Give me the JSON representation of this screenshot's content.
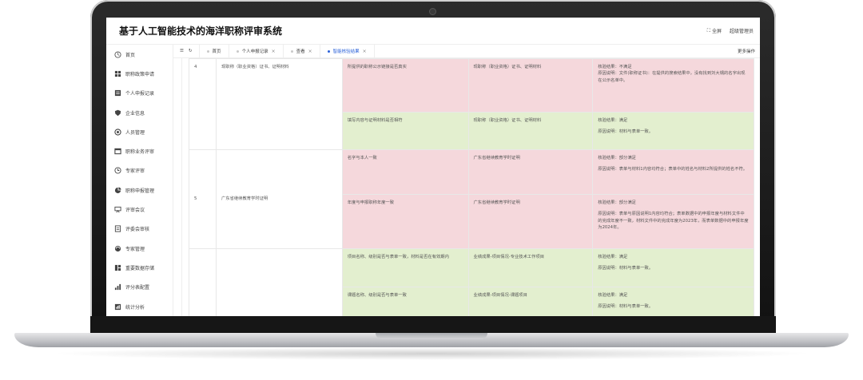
{
  "app": {
    "title": "基于人工智能技术的海洋职称评审系统",
    "fullscreen_label": "全屏",
    "user_label": "超级管理员"
  },
  "sidebar": {
    "items": [
      {
        "label": "首页",
        "icon": "home-icon"
      },
      {
        "label": "职称政策申请",
        "icon": "grid-icon"
      },
      {
        "label": "个人申报记录",
        "icon": "record-icon"
      },
      {
        "label": "企业信息",
        "icon": "shield-icon"
      },
      {
        "label": "人员管理",
        "icon": "person-icon"
      },
      {
        "label": "职称业务评审",
        "icon": "review-icon"
      },
      {
        "label": "专家评审",
        "icon": "clock-icon"
      },
      {
        "label": "职称申报管理",
        "icon": "pie-icon"
      },
      {
        "label": "评审会议",
        "icon": "meeting-icon"
      },
      {
        "label": "评委会审核",
        "icon": "audit-icon"
      },
      {
        "label": "专家管理",
        "icon": "expert-icon"
      },
      {
        "label": "重要数据存储",
        "icon": "storage-icon"
      },
      {
        "label": "评分表配置",
        "icon": "config-icon"
      },
      {
        "label": "统计分析",
        "icon": "stats-icon"
      }
    ]
  },
  "tabs": {
    "items": [
      {
        "label": "首页",
        "closable": false,
        "active": false
      },
      {
        "label": "个人申报记录",
        "closable": true,
        "active": false
      },
      {
        "label": "查看",
        "closable": true,
        "active": false
      },
      {
        "label": "智能核验结果",
        "closable": true,
        "active": true
      }
    ],
    "close_glyph": "×",
    "right_label": "更多操作"
  },
  "table": {
    "groups": [
      {
        "no": "4",
        "name": "现职称（职业资格）证书、证明材料",
        "rows": [
          {
            "status": "fail",
            "condition": "所提供的职称公示链接是否真实",
            "source": "现职称（职业资格）证书、证明材料",
            "result_title": "核验结果：不满足",
            "result_reason": "原因说明：文件(职称证书)：在提供的搜索结果中，没有找到刘大锅的名字出现在公示名单中。"
          },
          {
            "status": "pass",
            "condition": "填写内容与证明材料是否相符",
            "source": "现职称（职业资格）证书、证明材料",
            "result_title": "核验结果：满足",
            "result_reason": "原因说明：材料与表单一致。"
          }
        ]
      },
      {
        "no": "5",
        "name": "广东省继续教育学时证明",
        "rows": [
          {
            "status": "fail",
            "condition": "名字与本人一致",
            "source": "广东省继续教育学时证明",
            "result_title": "核验结果：部分满足",
            "result_reason": "原因说明：表单与材料1内容均符合；表单中的姓名与材料2所提供的姓名不符。"
          },
          {
            "status": "fail",
            "condition": "年度与申报职称年度一致",
            "source": "广东省继续教育学时证明",
            "result_title": "核验结果：部分满足",
            "result_reason": "原因说明：表单与原因说明1内容均符合；表单数据中的申报年度与材料文件中的完成年度不一致，材料文件中的完成年度为2023年，而表单数据中的申报年度为2024年。"
          }
        ]
      },
      {
        "no": "",
        "name": "",
        "rows": [
          {
            "status": "pass",
            "condition": "项目名称、级别是否与表单一致，材料是否在有效期内",
            "source": "业绩成果-项目情况-专业技术工作项目",
            "result_title": "核验结果：满足",
            "result_reason": "原因说明：材料与表单一致。"
          },
          {
            "status": "pass",
            "condition": "课题名称、级别是否与表单一致",
            "source": "业绩成果-项目情况-课题项目",
            "result_title": "核验结果：满足",
            "result_reason": "原因说明：材料与表单一致。"
          }
        ]
      }
    ]
  },
  "colors": {
    "fail_bg": "#f5d8dc",
    "pass_bg": "#e3efcf",
    "accent": "#2b62d9"
  }
}
